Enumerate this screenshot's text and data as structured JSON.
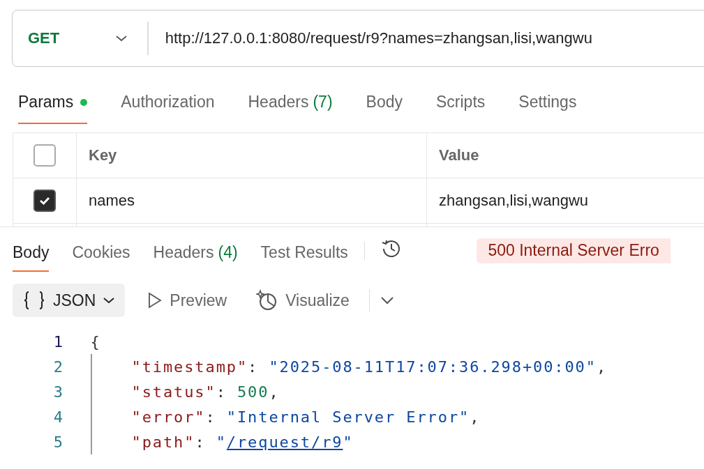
{
  "request": {
    "method": "GET",
    "url": "http://127.0.0.1:8080/request/r9?names=zhangsan,lisi,wangwu"
  },
  "request_tabs": [
    {
      "label": "Params",
      "dot": true,
      "selected": true
    },
    {
      "label": "Authorization",
      "selected": false
    },
    {
      "label": "Headers",
      "count": "(7)",
      "selected": false
    },
    {
      "label": "Body",
      "selected": false
    },
    {
      "label": "Scripts",
      "selected": false
    },
    {
      "label": "Settings",
      "selected": false
    }
  ],
  "params_table": {
    "columns": [
      "Key",
      "Value"
    ],
    "header_checked": false,
    "rows": [
      {
        "checked": true,
        "key": "names",
        "value": "zhangsan,lisi,wangwu"
      }
    ]
  },
  "response_tabs": [
    {
      "label": "Body",
      "selected": true
    },
    {
      "label": "Cookies",
      "selected": false
    },
    {
      "label": "Headers",
      "count": "(4)",
      "selected": false
    },
    {
      "label": "Test Results",
      "selected": false
    }
  ],
  "status_badge": "500 Internal Server Erro",
  "view_options": [
    {
      "kind": "format",
      "label": "JSON",
      "selected": true
    },
    {
      "kind": "preview",
      "label": "Preview",
      "selected": false
    },
    {
      "kind": "visualize",
      "label": "Visualize",
      "selected": false
    }
  ],
  "code": {
    "lines": [
      {
        "number": "1",
        "tokens": [
          {
            "kind": "punct",
            "text": "{"
          }
        ],
        "children": [
          {
            "number": "2",
            "tokens": [
              {
                "kind": "key",
                "text": "\"timestamp\""
              },
              {
                "kind": "punct",
                "text": ": "
              },
              {
                "kind": "string",
                "text": "\"2025-08-11T17:07:36.298+00:00\""
              },
              {
                "kind": "punct",
                "text": ","
              }
            ]
          },
          {
            "number": "3",
            "tokens": [
              {
                "kind": "key",
                "text": "\"status\""
              },
              {
                "kind": "punct",
                "text": ": "
              },
              {
                "kind": "number",
                "text": "500"
              },
              {
                "kind": "punct",
                "text": ","
              }
            ]
          },
          {
            "number": "4",
            "tokens": [
              {
                "kind": "key",
                "text": "\"error\""
              },
              {
                "kind": "punct",
                "text": ": "
              },
              {
                "kind": "string",
                "text": "\"Internal Server Error\""
              },
              {
                "kind": "punct",
                "text": ","
              }
            ]
          },
          {
            "number": "5",
            "tokens": [
              {
                "kind": "key",
                "text": "\"path\""
              },
              {
                "kind": "punct",
                "text": ": "
              },
              {
                "kind": "string",
                "text": "\""
              },
              {
                "kind": "link",
                "text": "/request/r9"
              },
              {
                "kind": "string",
                "text": "\""
              }
            ]
          }
        ]
      }
    ]
  }
}
